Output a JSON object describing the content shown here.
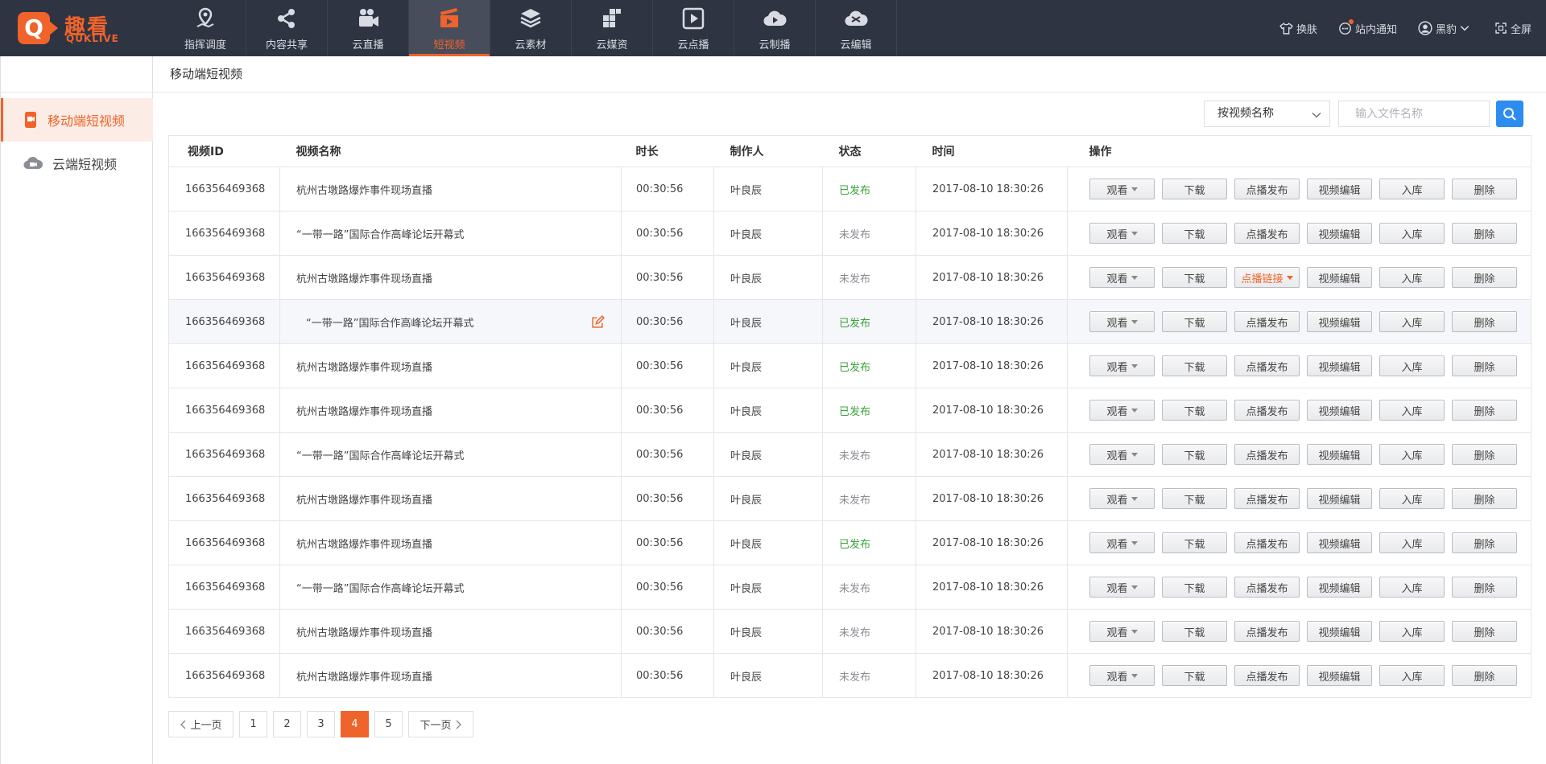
{
  "brand": {
    "logo_letter": "Q",
    "name": "趣看",
    "sub": "QUKLIVE"
  },
  "nav": [
    {
      "label": "指挥调度",
      "icon": "map-pin-icon"
    },
    {
      "label": "内容共享",
      "icon": "share-icon"
    },
    {
      "label": "云直播",
      "icon": "video-camera-icon"
    },
    {
      "label": "短视频",
      "icon": "clapperboard-icon",
      "active": true
    },
    {
      "label": "云素材",
      "icon": "layers-icon"
    },
    {
      "label": "云媒资",
      "icon": "media-asset-icon"
    },
    {
      "label": "云点播",
      "icon": "play-icon"
    },
    {
      "label": "云制播",
      "icon": "cloud-play-icon"
    },
    {
      "label": "云编辑",
      "icon": "cloud-edit-icon"
    }
  ],
  "topright": {
    "skin": "换肤",
    "notice": "站内通知",
    "user": "黑豹",
    "fullscreen": "全屏"
  },
  "sidebar": {
    "items": [
      {
        "label": "移动端短视频",
        "icon": "mobile-video-icon",
        "active": true
      },
      {
        "label": "云端短视频",
        "icon": "cloud-video-icon"
      }
    ]
  },
  "breadcrumb": "移动端短视频",
  "search": {
    "select_value": "按视频名称",
    "placeholder": "输入文件名称"
  },
  "table": {
    "headers": {
      "id": "视频ID",
      "name": "视频名称",
      "duration": "时长",
      "maker": "制作人",
      "status": "状态",
      "time": "时间",
      "ops": "操作"
    },
    "rows": [
      {
        "id": "166356469368",
        "name": "杭州古墩路爆炸事件现场直播",
        "duration": "00:30:56",
        "maker": "叶良辰",
        "status": "已发布",
        "published": true,
        "time": "2017-08-10  18:30:26",
        "publish_op": "点播发布"
      },
      {
        "id": "166356469368",
        "name": "“一带一路”国际合作高峰论坛开幕式",
        "duration": "00:30:56",
        "maker": "叶良辰",
        "status": "未发布",
        "published": false,
        "time": "2017-08-10  18:30:26",
        "publish_op": "点播发布"
      },
      {
        "id": "166356469368",
        "name": "杭州古墩路爆炸事件现场直播",
        "duration": "00:30:56",
        "maker": "叶良辰",
        "status": "未发布",
        "published": false,
        "time": "2017-08-10  18:30:26",
        "publish_op": "点播链接"
      },
      {
        "id": "166356469368",
        "name": "“一带一路”国际合作高峰论坛开幕式",
        "duration": "00:30:56",
        "maker": "叶良辰",
        "status": "已发布",
        "published": true,
        "time": "2017-08-10  18:30:26",
        "publish_op": "点播发布",
        "highlight": true
      },
      {
        "id": "166356469368",
        "name": "杭州古墩路爆炸事件现场直播",
        "duration": "00:30:56",
        "maker": "叶良辰",
        "status": "已发布",
        "published": true,
        "time": "2017-08-10  18:30:26",
        "publish_op": "点播发布"
      },
      {
        "id": "166356469368",
        "name": "杭州古墩路爆炸事件现场直播",
        "duration": "00:30:56",
        "maker": "叶良辰",
        "status": "已发布",
        "published": true,
        "time": "2017-08-10  18:30:26",
        "publish_op": "点播发布"
      },
      {
        "id": "166356469368",
        "name": "“一带一路”国际合作高峰论坛开幕式",
        "duration": "00:30:56",
        "maker": "叶良辰",
        "status": "未发布",
        "published": false,
        "time": "2017-08-10  18:30:26",
        "publish_op": "点播发布"
      },
      {
        "id": "166356469368",
        "name": "杭州古墩路爆炸事件现场直播",
        "duration": "00:30:56",
        "maker": "叶良辰",
        "status": "未发布",
        "published": false,
        "time": "2017-08-10  18:30:26",
        "publish_op": "点播发布"
      },
      {
        "id": "166356469368",
        "name": "杭州古墩路爆炸事件现场直播",
        "duration": "00:30:56",
        "maker": "叶良辰",
        "status": "已发布",
        "published": true,
        "time": "2017-08-10  18:30:26",
        "publish_op": "点播发布"
      },
      {
        "id": "166356469368",
        "name": "“一带一路”国际合作高峰论坛开幕式",
        "duration": "00:30:56",
        "maker": "叶良辰",
        "status": "未发布",
        "published": false,
        "time": "2017-08-10  18:30:26",
        "publish_op": "点播发布"
      },
      {
        "id": "166356469368",
        "name": "杭州古墩路爆炸事件现场直播",
        "duration": "00:30:56",
        "maker": "叶良辰",
        "status": "未发布",
        "published": false,
        "time": "2017-08-10  18:30:26",
        "publish_op": "点播发布"
      },
      {
        "id": "166356469368",
        "name": "杭州古墩路爆炸事件现场直播",
        "duration": "00:30:56",
        "maker": "叶良辰",
        "status": "未发布",
        "published": false,
        "time": "2017-08-10  18:30:26",
        "publish_op": "点播发布"
      }
    ],
    "ops": {
      "watch": "观看",
      "download": "下载",
      "edit": "视频编辑",
      "store": "入库",
      "delete": "删除"
    }
  },
  "pager": {
    "prev": "上一页",
    "next": "下一页",
    "pages": [
      "1",
      "2",
      "3",
      "4",
      "5"
    ],
    "current": "4"
  },
  "colors": {
    "accent": "#f0632b",
    "topbar": "#2f3443",
    "published": "#3aa23a",
    "unpublished": "#8a8d93",
    "search_button": "#2d8cf0"
  }
}
